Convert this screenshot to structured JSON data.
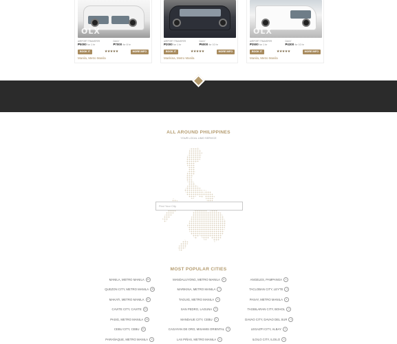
{
  "listings": [
    {
      "watermark": "OLX",
      "left_label": "AIRPORT TRANSFER",
      "left_price": "₱5000",
      "left_unit": "for 1 hr",
      "right_label": "DAILY",
      "right_price": "₱7000",
      "right_unit": "for 8 hr",
      "book_label": "BOOK IT",
      "stars": "★★★★★",
      "more_label": "MORE INFO",
      "location": "Manila, Metro Manila"
    },
    {
      "watermark": "",
      "left_label": "AIRPORT TRANSFER",
      "left_price": "₱2000",
      "left_unit": "for 1 hr",
      "right_label": "DAILY",
      "right_price": "₱6000",
      "right_unit": "for 10 hr",
      "book_label": "BOOK IT",
      "stars": "★★★★★",
      "more_label": "MORE INFO",
      "location": "Marikina, Metro Manila"
    },
    {
      "watermark": "OLX",
      "left_label": "AIRPORT TRANSFER",
      "left_price": "₱3500",
      "left_unit": "for 1 hr",
      "right_label": "DAILY",
      "right_price": "₱4300",
      "right_unit": "for 10 hr",
      "book_label": "BOOK IT",
      "stars": "★★★★★",
      "more_label": "MORE INFO",
      "location": "Manila, Metro Manila"
    }
  ],
  "region": {
    "title": "ALL AROUND PHILIPPINES",
    "subtitle": "YOUR LOCAL LIMO SERVICE",
    "search_placeholder": "Find Your City"
  },
  "popular": {
    "title": "MOST POPULAR CITIES",
    "cities": [
      {
        "name": "MANILA, METRO MANILA",
        "count": "44"
      },
      {
        "name": "MANDALUYONG, METRO MANILA",
        "count": "8"
      },
      {
        "name": "ANGELES, PAMPANGA",
        "count": "4"
      },
      {
        "name": "QUEZON CITY, METRO MANILA",
        "count": "40"
      },
      {
        "name": "MARIKINA, METRO MANILA",
        "count": "7"
      },
      {
        "name": "TACLOBAN CITY, LEYTE",
        "count": "4"
      },
      {
        "name": "MAKATI, METRO MANILA",
        "count": "17"
      },
      {
        "name": "TAGUIG, METRO MANILA",
        "count": "6"
      },
      {
        "name": "PASAY, METRO MANILA",
        "count": "4"
      },
      {
        "name": "CAVITE CITY, CAVITE",
        "count": "14"
      },
      {
        "name": "SAN PEDRO, LAGUNA",
        "count": "5"
      },
      {
        "name": "TAGBILARAN CITY, BOHOL",
        "count": "4"
      },
      {
        "name": "PASIG, METRO MANILA",
        "count": "12"
      },
      {
        "name": "MANDAUE CITY, CEBU",
        "count": "5"
      },
      {
        "name": "DAVAO CITY, DAVAO DEL SUR",
        "count": "4"
      },
      {
        "name": "CEBU CITY, CEBU",
        "count": "10"
      },
      {
        "name": "CAGAYAN DE ORO, MISAMIS ORIENTAL",
        "count": "5"
      },
      {
        "name": "LEGAZPI CITY, ALBAY",
        "count": "3"
      },
      {
        "name": "PARAÑAQUE, METRO MANILA",
        "count": "9"
      },
      {
        "name": "LAS PIÑAS, METRO MANILA",
        "count": "4"
      },
      {
        "name": "ILOILO CITY, ILOILO",
        "count": "3"
      }
    ]
  },
  "colors": {
    "accent": "#b39a6d",
    "dark_band": "#2b2b2b",
    "button": "#a88b5e"
  }
}
